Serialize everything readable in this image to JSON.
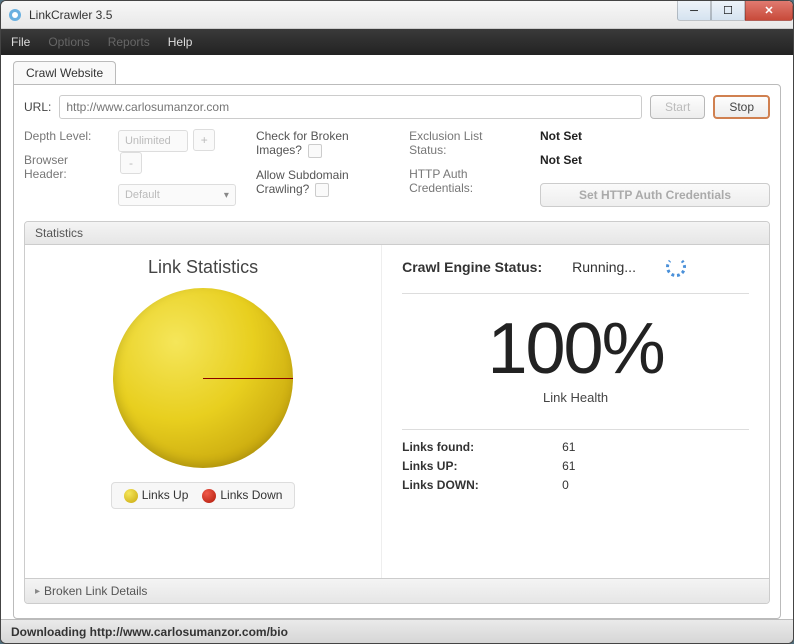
{
  "window": {
    "title": "LinkCrawler 3.5"
  },
  "menu": {
    "file": "File",
    "options": "Options",
    "reports": "Reports",
    "help": "Help"
  },
  "tab": {
    "crawl": "Crawl Website"
  },
  "url": {
    "label": "URL:",
    "placeholder": "http://www.carlosumanzor.com",
    "start": "Start",
    "stop": "Stop"
  },
  "settings": {
    "depth_label": "Depth Level:",
    "depth_value": "Unlimited",
    "browser_label": "Browser Header:",
    "browser_value": "Default",
    "broken_img": "Check for Broken Images?",
    "subdomain": "Allow Subdomain Crawling?",
    "excl_label": "Exclusion List Status:",
    "excl_value": "Not Set",
    "auth_label": "HTTP Auth Credentials:",
    "auth_value": "Not Set",
    "auth_btn": "Set HTTP Auth Credentials"
  },
  "stats": {
    "header": "Statistics",
    "chart_title": "Link Statistics",
    "legend_up": "Links Up",
    "legend_down": "Links Down",
    "engine_label": "Crawl Engine Status:",
    "engine_value": "Running...",
    "percent": "100%",
    "health": "Link Health",
    "found_label": "Links found:",
    "found_value": "61",
    "up_label": "Links UP:",
    "up_value": "61",
    "down_label": "Links DOWN:",
    "down_value": "0",
    "accordion": "Broken Link Details"
  },
  "statusbar": "Downloading http://www.carlosumanzor.com/bio",
  "chart_data": {
    "type": "pie",
    "title": "Link Statistics",
    "series": [
      {
        "name": "Links Up",
        "value": 61,
        "color": "#e8cf1f"
      },
      {
        "name": "Links Down",
        "value": 0,
        "color": "#c84a3a"
      }
    ]
  }
}
